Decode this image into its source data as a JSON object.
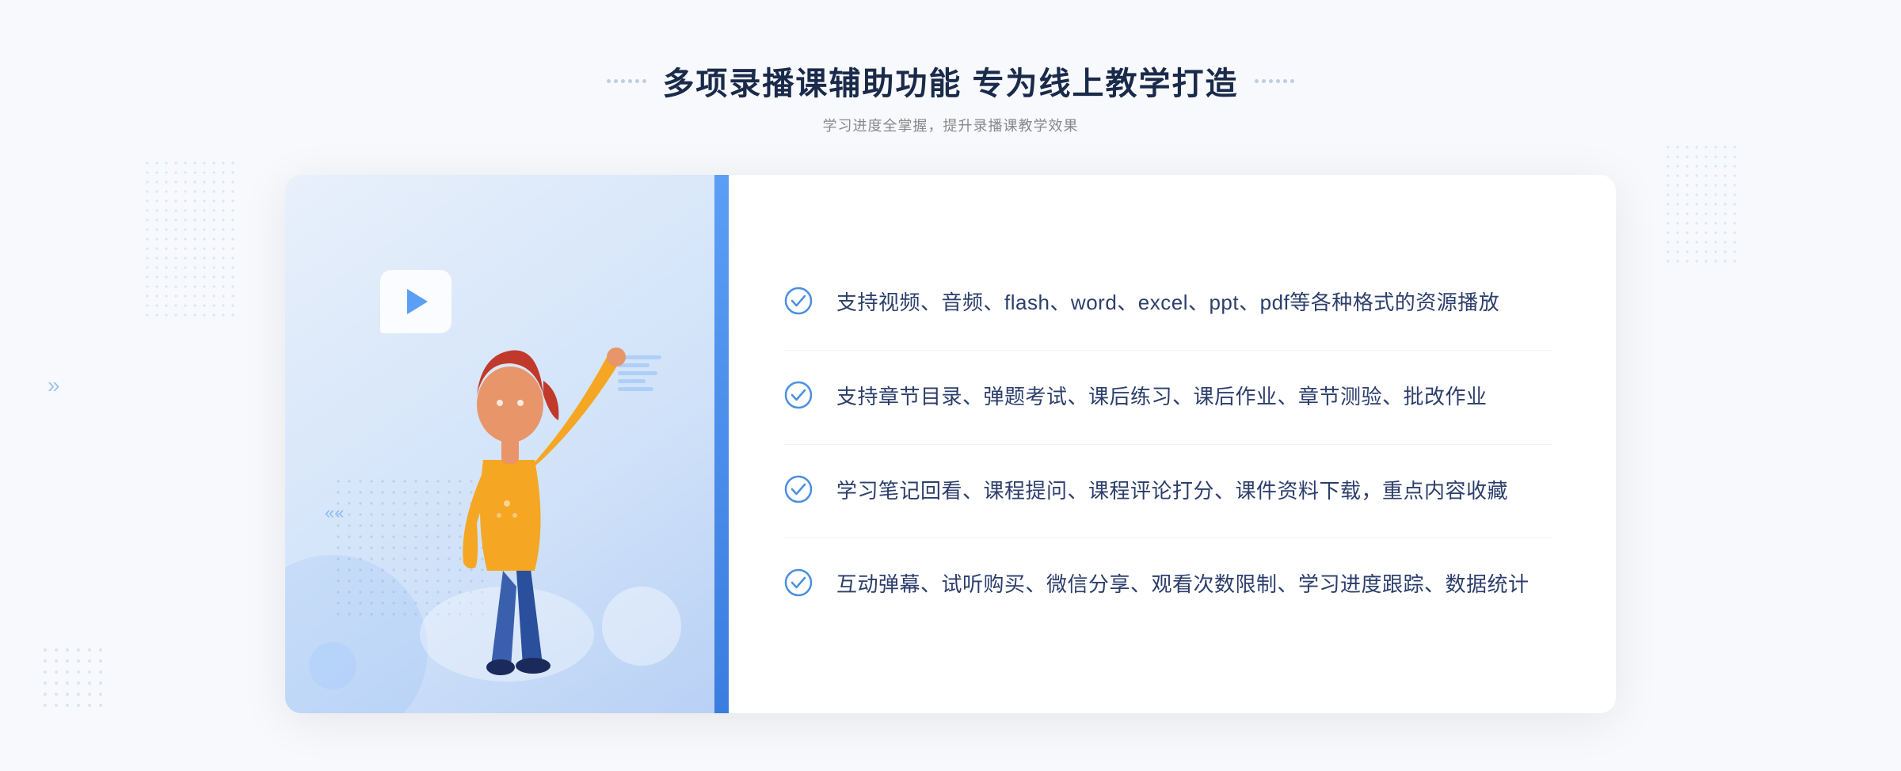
{
  "page": {
    "background_color": "#f8f9fc"
  },
  "header": {
    "title": "多项录播课辅助功能 专为线上教学打造",
    "subtitle": "学习进度全掌握，提升录播课教学效果",
    "dots_icon_left": "decorative-dots",
    "dots_icon_right": "decorative-dots"
  },
  "features": [
    {
      "id": 1,
      "text": "支持视频、音频、flash、word、excel、ppt、pdf等各种格式的资源播放"
    },
    {
      "id": 2,
      "text": "支持章节目录、弹题考试、课后练习、课后作业、章节测验、批改作业"
    },
    {
      "id": 3,
      "text": "学习笔记回看、课程提问、课程评论打分、课件资料下载，重点内容收藏"
    },
    {
      "id": 4,
      "text": "互动弹幕、试听购买、微信分享、观看次数限制、学习进度跟踪、数据统计"
    }
  ],
  "icons": {
    "check_circle": "check-circle-icon",
    "play": "play-icon",
    "chevron_left": "chevron-left-icon",
    "dots_decoration": "dots-decoration-icon"
  },
  "colors": {
    "accent_blue": "#4a8fe0",
    "title_dark": "#1a2a4a",
    "text_body": "#2c3e6b",
    "subtitle_gray": "#888888",
    "bg_light": "#f8f9fc",
    "card_bg": "#ffffff",
    "illustration_bg": "#dce9fb"
  }
}
